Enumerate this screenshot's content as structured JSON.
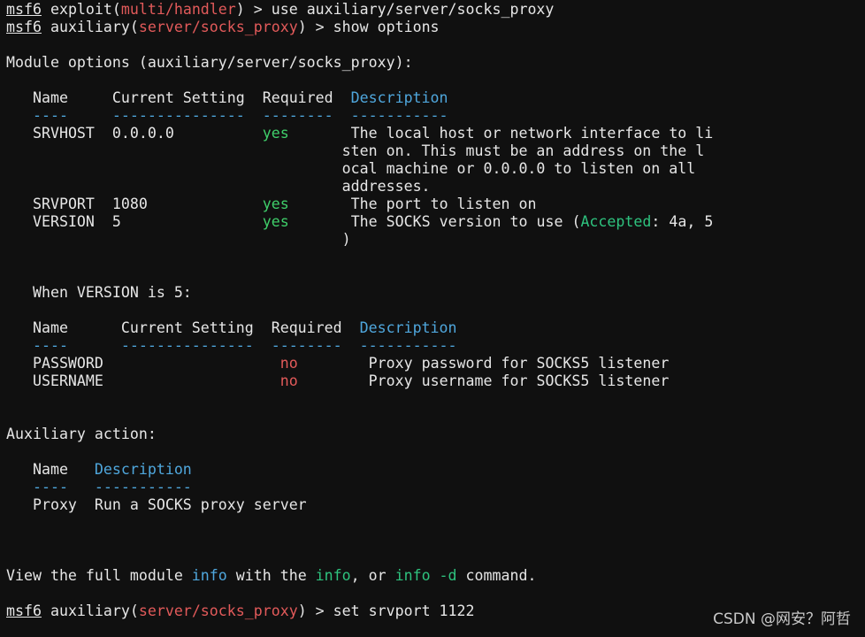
{
  "prompt_label": "msf6",
  "line1": {
    "pre": " exploit(",
    "module": "multi/handler",
    "post": ") > use auxiliary/server/socks_proxy"
  },
  "line2": {
    "pre": " auxiliary(",
    "module": "server/socks_proxy",
    "post": ") > show options"
  },
  "module_options_title": "Module options (auxiliary/server/socks_proxy):",
  "options_header": {
    "pre": "   Name     Current Setting  Required  ",
    "desc": "Description"
  },
  "options_sep": {
    "pre": "   ----     ---------------  --------  ",
    "desc": "-----------"
  },
  "options_rows": [
    {
      "name": "SRVHOST",
      "pad_after_name": "  ",
      "setting": "0.0.0.0",
      "pad_after_setting": "          ",
      "required": "yes",
      "pad_after_required": "       ",
      "desc": "The local host or network interface to li"
    },
    {
      "cont": "sten on. This must be an address on the l"
    },
    {
      "cont": "ocal machine or 0.0.0.0 to listen on all"
    },
    {
      "cont": "addresses."
    },
    {
      "name": "SRVPORT",
      "pad_after_name": "  ",
      "setting": "1080",
      "pad_after_setting": "             ",
      "required": "yes",
      "pad_after_required": "       ",
      "desc": "The port to listen on"
    },
    {
      "name": "VERSION",
      "pad_after_name": "  ",
      "setting": "5",
      "pad_after_setting": "                ",
      "required": "yes",
      "pad_after_required": "       ",
      "desc_pre": "The SOCKS version to use (",
      "desc_kw": "Accepted",
      "desc_post": ": 4a, 5"
    },
    {
      "cont": ")"
    }
  ],
  "when_version": "   When VERSION is 5:",
  "version_header": {
    "pre": "   Name      Current Setting  Required  ",
    "desc": "Description"
  },
  "version_sep": {
    "pre": "   ----      ---------------  --------  ",
    "desc": "-----------"
  },
  "version_rows": [
    {
      "name": "   PASSWORD",
      "pad": "                    ",
      "required": "no",
      "pad2": "        ",
      "desc": "Proxy password for SOCKS5 listener"
    },
    {
      "name": "   USERNAME",
      "pad": "                    ",
      "required": "no",
      "pad2": "        ",
      "desc": "Proxy username for SOCKS5 listener"
    }
  ],
  "aux_action_title": "Auxiliary action:",
  "action_header": {
    "pre": "   Name   ",
    "desc": "Description"
  },
  "action_sep": {
    "pre": "   ----   ",
    "desc": "-----------"
  },
  "action_row": {
    "name": "   Proxy  ",
    "desc": "Run a SOCKS proxy server"
  },
  "view_info": {
    "a": "View the full module ",
    "b": "info",
    "c": " with the ",
    "d": "info",
    "e": ", or ",
    "f": "info -d",
    "g": " command."
  },
  "last_line": {
    "pre": " auxiliary(",
    "module": "server/socks_proxy",
    "post": ") > set srvport 1122"
  },
  "watermark": "CSDN @网安？阿哲",
  "colors": {
    "module_red": "#e25a5a",
    "required_green": "#3fcf6a",
    "required_red": "#e25a5a",
    "header_blue": "#4fa7dd",
    "info_green": "#2ec27e",
    "background": "#101010",
    "text": "#e6e6e6"
  }
}
